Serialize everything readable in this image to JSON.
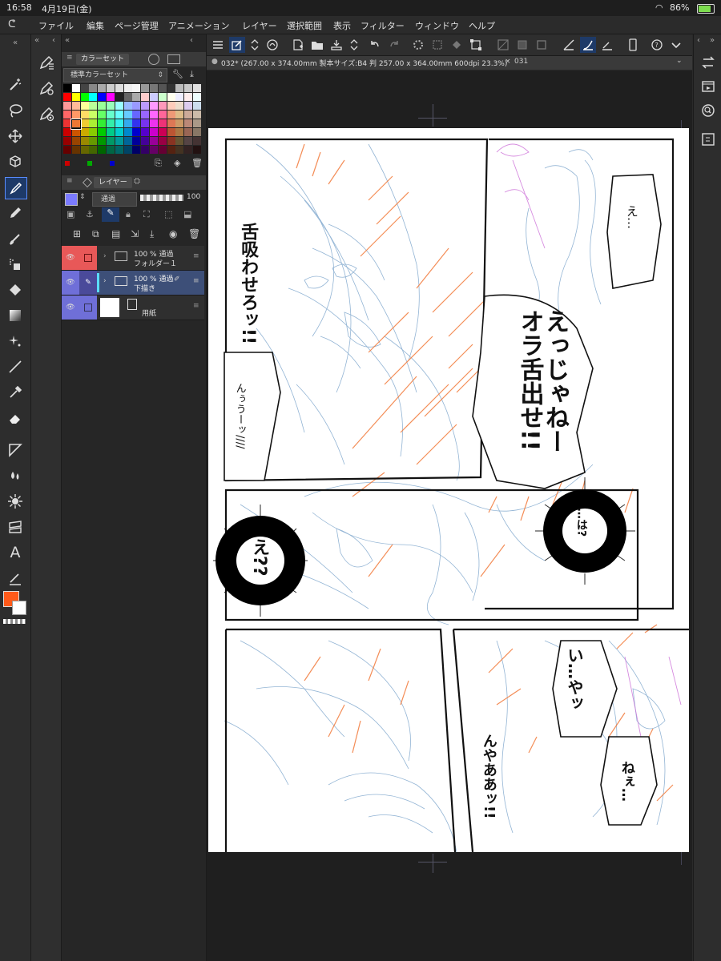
{
  "status": {
    "time": "16:58",
    "date": "4月19日(金)",
    "battery": "86%"
  },
  "menu": [
    "ファイル",
    "編集",
    "ページ管理",
    "アニメーション",
    "レイヤー",
    "選択範囲",
    "表示",
    "フィルター",
    "ウィンドウ",
    "ヘルプ"
  ],
  "color_panel": {
    "tab_label": "カラーセット",
    "set_name": "標準カラーセット"
  },
  "layer_panel": {
    "tab_label": "レイヤー",
    "blend_mode": "通過",
    "opacity": "100",
    "layers": [
      {
        "mode": "100 % 通過",
        "name": "フォルダー１",
        "color": "#e85858"
      },
      {
        "mode": "100 % 通過",
        "name": "下描き",
        "color": "#6f6fd8"
      },
      {
        "mode": "",
        "name": "用紙",
        "color": "#6f6fd8"
      }
    ]
  },
  "document": {
    "active_tab": "032* (267.00 x 374.00mm 製本サイズ:B4 判 257.00 x 364.00mm 600dpi 23.3%)",
    "other_tab": "031"
  },
  "comic": {
    "bubbles": [
      {
        "text": "え…"
      },
      {
        "text": "舌吸わせろッ!!"
      },
      {
        "text": "えっじゃねーオラ舌出せ!!"
      },
      {
        "text": "んぅうーッ////"
      },
      {
        "text": "…は?"
      },
      {
        "text": "え??"
      },
      {
        "text": "い…やッ"
      },
      {
        "text": "んやああッ!!"
      },
      {
        "text": "ねぇ…"
      }
    ]
  },
  "colors": {
    "foreground": "#ff5a1a",
    "background": "#ffffff",
    "accent": "#5a8cff"
  }
}
